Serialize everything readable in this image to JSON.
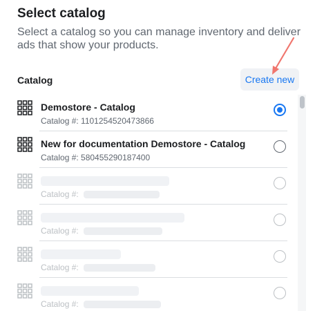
{
  "header": {
    "title": "Select catalog",
    "description": "Select a catalog so you can manage inventory and deliver ads that show your products."
  },
  "catalog_section": {
    "label": "Catalog",
    "create_new_label": "Create new"
  },
  "catalogs": [
    {
      "name": "Demostore - Catalog",
      "catalog_id_text": "Catalog #: 1101254520473866",
      "selected": true
    },
    {
      "name": "New for documentation Demostore - Catalog",
      "catalog_id_text": "Catalog #: 580455290187400",
      "selected": false
    },
    {
      "name": "",
      "catalog_id_text": "Catalog #:",
      "selected": false,
      "redacted": true
    },
    {
      "name": "",
      "catalog_id_text": "Catalog #:",
      "selected": false,
      "redacted": true
    },
    {
      "name": "",
      "catalog_id_text": "Catalog #:",
      "selected": false,
      "redacted": true
    },
    {
      "name": "",
      "catalog_id_text": "Catalog #:",
      "selected": false,
      "redacted": true
    }
  ],
  "icons": {
    "catalog_row_icon": "grid-icon",
    "annotation": "arrow-annotation-icon"
  },
  "colors": {
    "accent": "#1877f2",
    "annotation_arrow": "#f0766e",
    "muted_text": "#606770",
    "faded": "#bcc0c4"
  }
}
